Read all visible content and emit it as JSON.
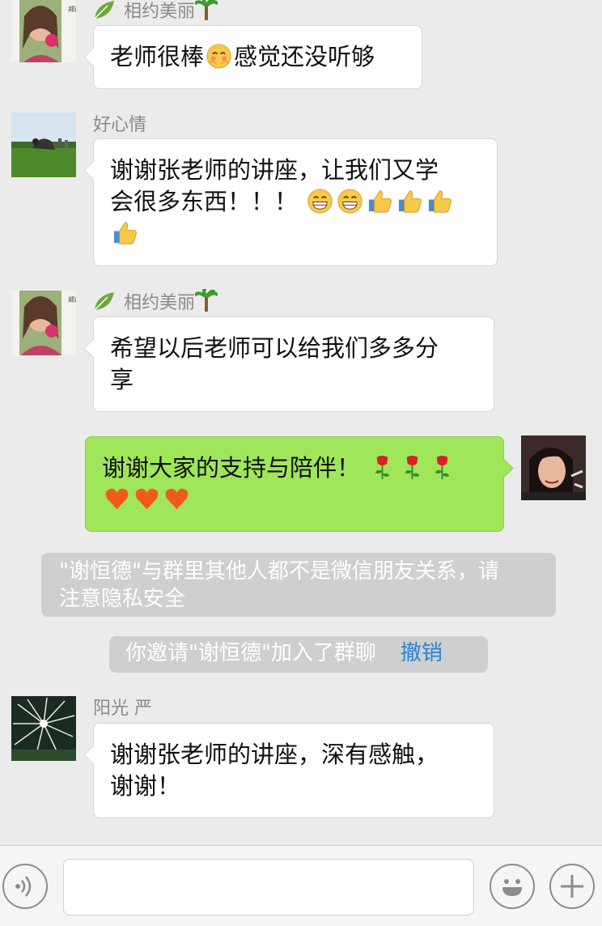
{
  "messages": [
    {
      "sender": "相约美丽",
      "text": "老师很棒",
      "text_after": "感觉还没听够"
    },
    {
      "sender": "好心情",
      "line1": "谢谢张老师的讲座，让我们又学",
      "line2": "会很多东西！！！"
    },
    {
      "sender": "相约美丽",
      "line1": "希望以后老师可以给我们多多分",
      "line2": "享"
    },
    {
      "line1": "谢谢大家的支持与陪伴！"
    },
    {
      "sender": "阳光 严",
      "line1": "谢谢张老师的讲座，深有感触，",
      "line2": "谢谢！"
    }
  ],
  "avatar_text": "郑燕远",
  "system": {
    "privacy_line1": "\"谢恒德\"与群里其他人都不是微信朋友关系，请",
    "privacy_line2": "注意隐私安全",
    "invite_text": "你邀请\"谢恒德\"加入了群聊",
    "undo_label": "撤销"
  },
  "colors": {
    "background": "#ebebeb",
    "own_bubble": "#9fe65a",
    "other_bubble": "#ffffff",
    "link": "#2b7fd8"
  },
  "icons": [
    "voice-icon",
    "emoji-icon",
    "plus-icon"
  ]
}
